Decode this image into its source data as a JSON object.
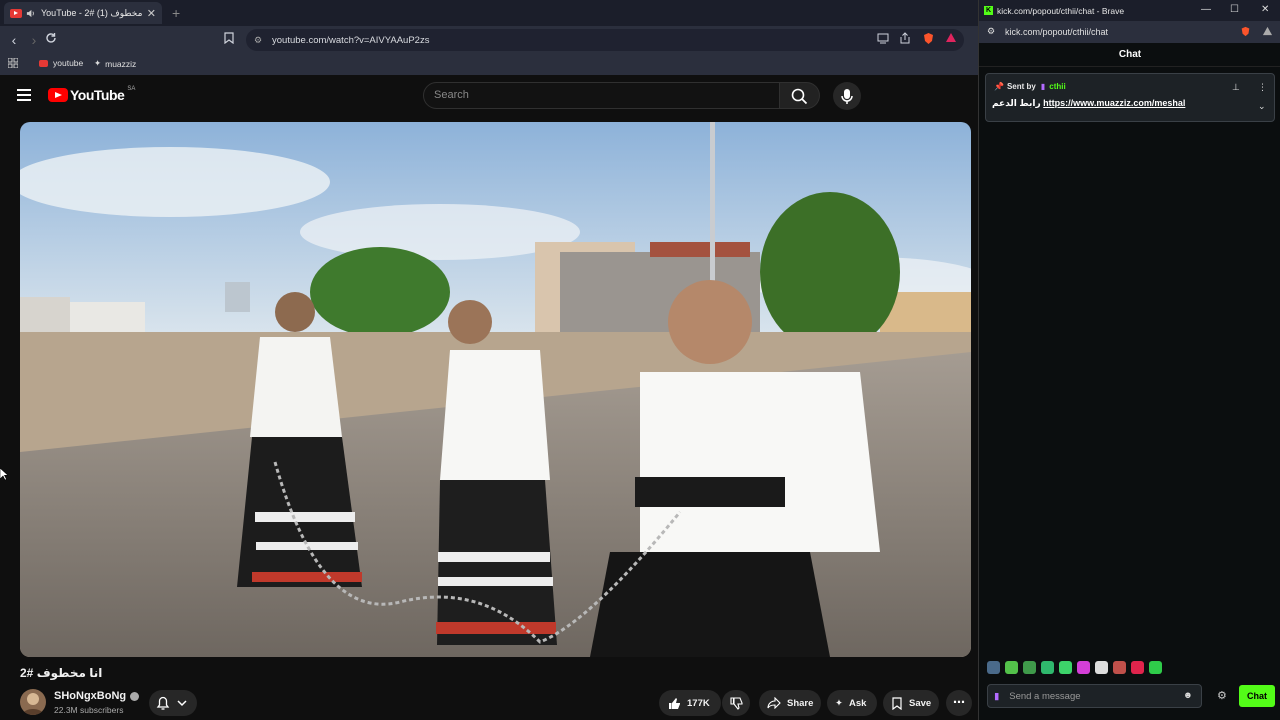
{
  "browser": {
    "tab_title": "YouTube - 2# انا مخطوف (1)",
    "new_tab_label": "+",
    "address": "youtube.com/watch?v=AIVYAAuP2zs",
    "bookmarks": [
      {
        "label": "youtube",
        "icon": "youtube-icon"
      },
      {
        "label": "muazziz",
        "icon": "muazziz-icon"
      }
    ]
  },
  "youtube": {
    "logo_text": "YouTube",
    "region": "SA",
    "search_placeholder": "Search",
    "video_title": "2# انا مخطوف",
    "channel_name": "SHoNgxBoNg",
    "subscribers": "22.3M subscribers",
    "actions": {
      "like_count": "177K",
      "share": "Share",
      "ask": "Ask",
      "save": "Save",
      "more": "⋯"
    }
  },
  "kick_window": {
    "title": "kick.com/popout/cthii/chat - Brave",
    "address": "kick.com/popout/cthii/chat",
    "chat_header": "Chat",
    "pinned": {
      "sent_by_label": "Sent by",
      "sender": "cthii",
      "message_prefix": "رابط الدعم",
      "message_link": "https://www.muazziz.com/meshal"
    },
    "input_placeholder": "Send a message",
    "send_label": "Chat"
  },
  "colors": {
    "kick_green": "#53fc18",
    "youtube_red": "#ff0000"
  }
}
